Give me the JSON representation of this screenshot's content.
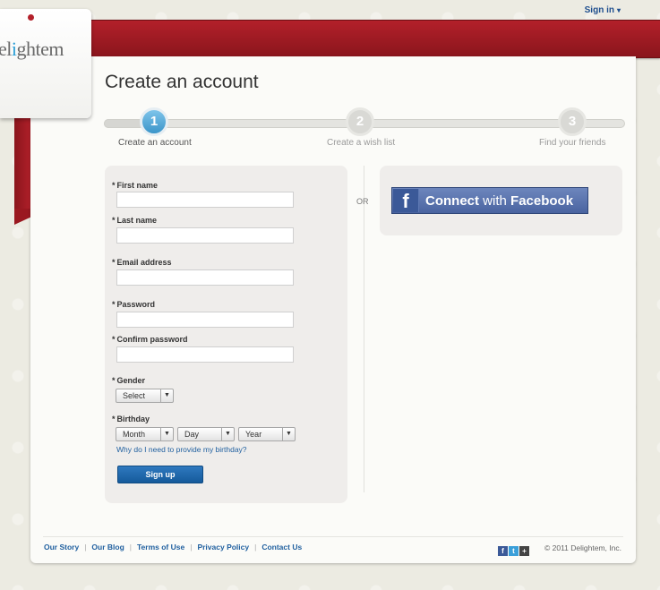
{
  "header": {
    "signin_label": "Sign in",
    "signin_caret": "▾"
  },
  "brand": {
    "logo_pre": "el",
    "logo_accent": "i",
    "logo_post": "ghtem"
  },
  "page": {
    "title": "Create an account"
  },
  "steps": [
    {
      "number": "1",
      "label": "Create an account",
      "active": true
    },
    {
      "number": "2",
      "label": "Create a wish list",
      "active": false
    },
    {
      "number": "3",
      "label": "Find your friends",
      "active": false
    }
  ],
  "form": {
    "required_marker": "*",
    "first_name_label": "First name",
    "last_name_label": "Last name",
    "email_label": "Email address",
    "password_label": "Password",
    "confirm_password_label": "Confirm password",
    "gender_label": "Gender",
    "gender_value": "Select",
    "birthday_label": "Birthday",
    "month_value": "Month",
    "day_value": "Day",
    "year_value": "Year",
    "birthday_help_link": "Why do I need to provide my birthday?",
    "signup_button": "Sign up"
  },
  "or_label": "OR",
  "facebook": {
    "f_glyph": "f",
    "connect_text": "Connect",
    "with_text": "with",
    "brand_text": "Facebook"
  },
  "footer": {
    "links": [
      "Our Story",
      "Our Blog",
      "Terms of Use",
      "Privacy Policy",
      "Contact Us"
    ],
    "separator": "|",
    "copyright": "© 2011 Delightem, Inc.",
    "social_icons": [
      "facebook-icon",
      "twitter-icon",
      "plus-icon"
    ]
  },
  "colors": {
    "ribbon": "#b3202a",
    "link": "#1f5f9f",
    "step_active": "#3b95c9",
    "facebook": "#3b5998"
  }
}
